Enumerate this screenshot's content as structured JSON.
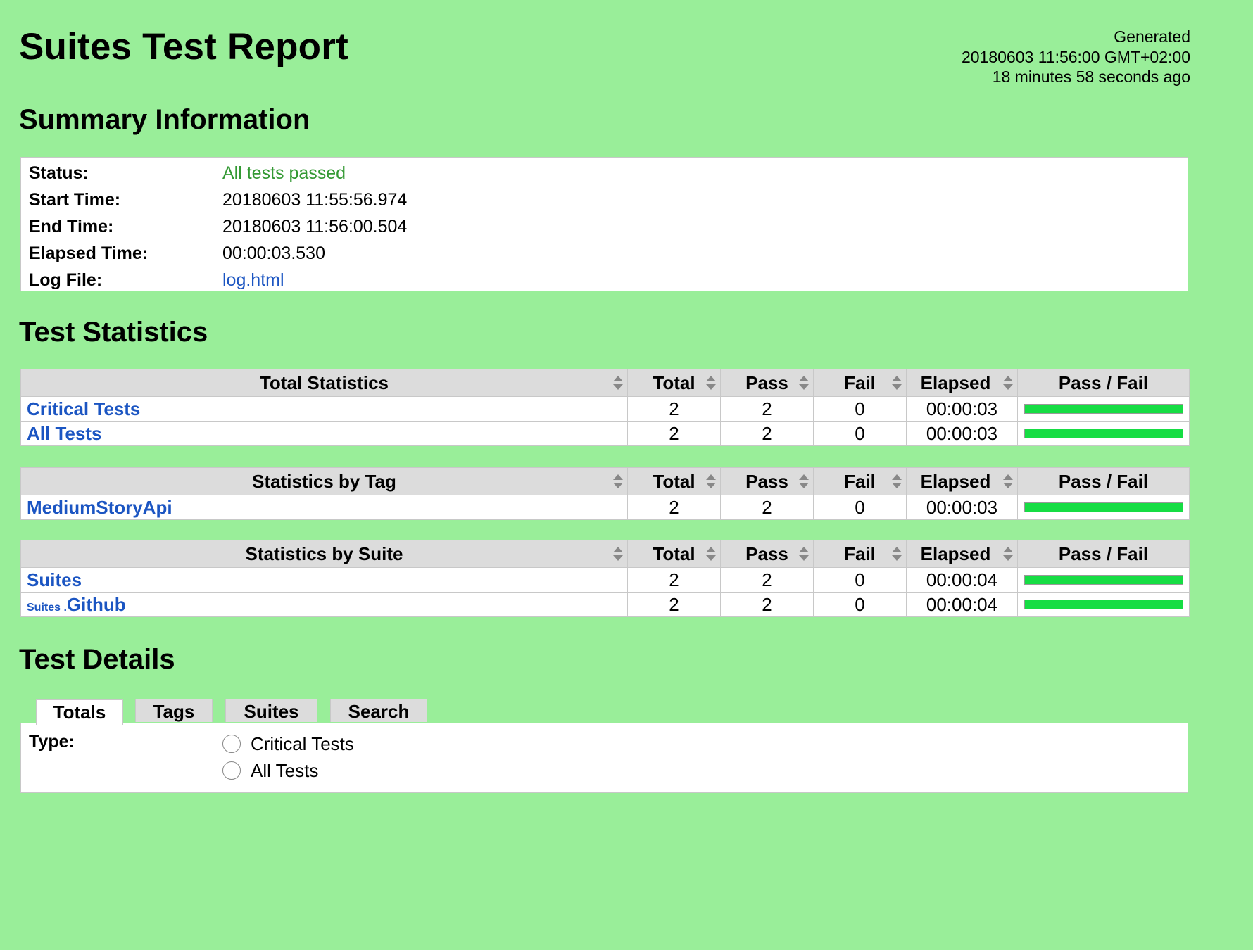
{
  "header": {
    "title": "Suites Test Report",
    "generated_label": "Generated",
    "generated_time": "20180603 11:56:00 GMT+02:00",
    "generated_ago": "18 minutes 58 seconds ago"
  },
  "summary": {
    "heading": "Summary Information",
    "rows": [
      {
        "label": "Status:",
        "value": "All tests passed"
      },
      {
        "label": "Start Time:",
        "value": "20180603 11:55:56.974"
      },
      {
        "label": "End Time:",
        "value": "20180603 11:56:00.504"
      },
      {
        "label": "Elapsed Time:",
        "value": "00:00:03.530"
      },
      {
        "label": "Log File:",
        "value": "log.html"
      }
    ]
  },
  "statistics": {
    "heading": "Test Statistics",
    "columns": {
      "total": "Total",
      "pass": "Pass",
      "fail": "Fail",
      "elapsed": "Elapsed",
      "pass_fail": "Pass / Fail"
    },
    "total_stats": {
      "title": "Total Statistics",
      "rows": [
        {
          "name": "Critical Tests",
          "total": "2",
          "pass": "2",
          "fail": "0",
          "elapsed": "00:00:03",
          "pass_fraction": 1.0
        },
        {
          "name": "All Tests",
          "total": "2",
          "pass": "2",
          "fail": "0",
          "elapsed": "00:00:03",
          "pass_fraction": 1.0
        }
      ]
    },
    "tag_stats": {
      "title": "Statistics by Tag",
      "rows": [
        {
          "name": "MediumStoryApi",
          "total": "2",
          "pass": "2",
          "fail": "0",
          "elapsed": "00:00:03",
          "pass_fraction": 1.0
        }
      ]
    },
    "suite_stats": {
      "title": "Statistics by Suite",
      "rows": [
        {
          "parent": "",
          "name": "Suites",
          "total": "2",
          "pass": "2",
          "fail": "0",
          "elapsed": "00:00:04",
          "pass_fraction": 1.0
        },
        {
          "parent": "Suites .",
          "name": "Github",
          "total": "2",
          "pass": "2",
          "fail": "0",
          "elapsed": "00:00:04",
          "pass_fraction": 1.0
        }
      ]
    }
  },
  "details": {
    "heading": "Test Details",
    "tabs": [
      "Totals",
      "Tags",
      "Suites",
      "Search"
    ],
    "type_label": "Type:",
    "options": [
      "Critical Tests",
      "All Tests"
    ]
  },
  "colors": {
    "background": "#99ee99",
    "pass_green": "#16dd44",
    "link_blue": "#1b55c2",
    "status_green": "#339933"
  }
}
